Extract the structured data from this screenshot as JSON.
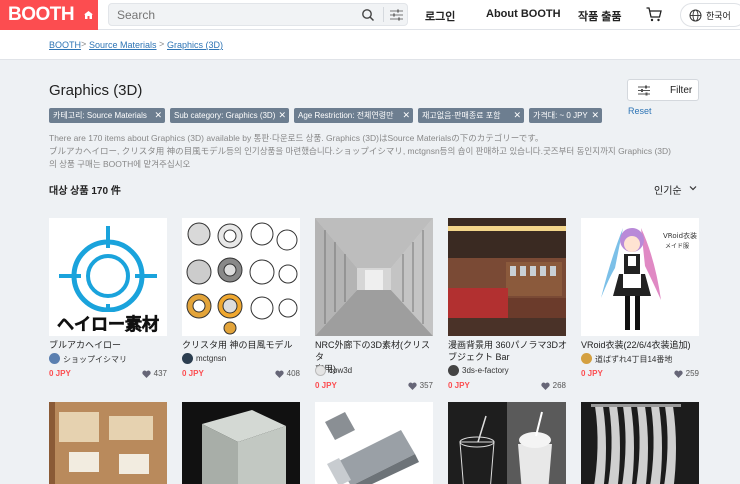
{
  "header": {
    "logo": "BOOTH",
    "search_placeholder": "Search",
    "login": "로그인",
    "about": "About BOOTH",
    "sell": "작품 출품",
    "language": "한국어"
  },
  "breadcrumb": {
    "items": [
      "BOOTH",
      "Source Materials",
      "Graphics (3D)"
    ],
    "separator": ">"
  },
  "page": {
    "title": "Graphics (3D)",
    "filter_label": "Filter",
    "reset_label": "Reset",
    "chips": [
      "카테고리: Source Materials",
      "Sub category: Graphics (3D)",
      "Age Restriction: 전체연령만",
      "재고없음·판매종료 포함",
      "가격대: ~ 0 JPY"
    ],
    "description_lines": [
      "There are 170 items about Graphics (3D) available by 통판·다운로드 상품. Graphics (3D)はSource Materialsの下のカテゴリーです。",
      "ブルアカヘイロー, クリスタ用 神の目風モデル등의 인기상품을 마련했습니다.ショップイシマリ, mctgnsn등의 숍이 판매하고 있습니다.굿즈부터 동인지까지 Graphics (3D)",
      "의 상품 구매는 BOOTH에 맡겨주십시오"
    ],
    "count": "대상 상품 170 件",
    "sort": "인기순"
  },
  "products": [
    {
      "title_lines": [
        "ブルアカヘイロー"
      ],
      "shop": "ショップイシマリ",
      "price": "0 JPY",
      "likes": "437"
    },
    {
      "title_lines": [
        "クリスタ用 神の目風モデル"
      ],
      "shop": "mctgnsn",
      "price": "0 JPY",
      "likes": "408"
    },
    {
      "title_lines": [
        "NRC外廊下の3D素材(クリスタ",
        "専用)"
      ],
      "shop": "cow3d",
      "price": "0 JPY",
      "likes": "357"
    },
    {
      "title_lines": [
        "漫画背景用 360パノラマ3Dオ",
        "ブジェクト Bar"
      ],
      "shop": "3ds-e-factory",
      "price": "0 JPY",
      "likes": "268"
    },
    {
      "title_lines": [
        "VRoid衣装(22/6/4衣装追加)"
      ],
      "shop": "道ばずれ4丁目14番地",
      "price": "0 JPY",
      "likes": "259"
    }
  ],
  "thumb_text": {
    "halo": "ヘイロー素材",
    "vroid_1": "VRoid衣装",
    "vroid_2": "メイド服"
  },
  "colors": {
    "brand": "#fc4d50",
    "link": "#2d74b5",
    "chip": "#6d7e90",
    "halo_blue": "#1aa3dc"
  }
}
